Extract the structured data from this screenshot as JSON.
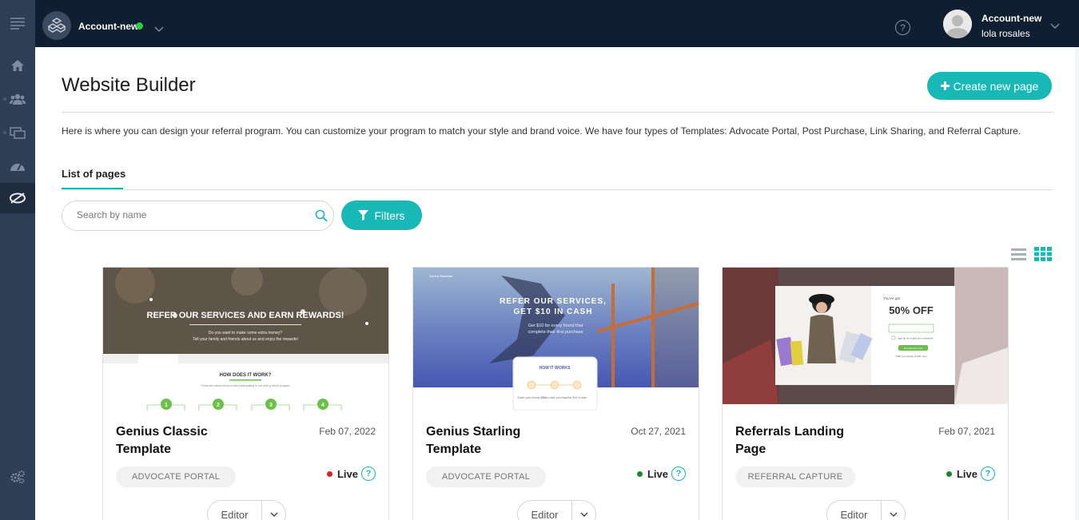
{
  "topbar": {
    "account_name": "Account-new",
    "user_account": "Account-new",
    "user_name": "lola rosales",
    "online_color": "#2ecc40"
  },
  "sidebar": {
    "items": [
      {
        "icon": "menu-icon"
      },
      {
        "icon": "home-icon"
      },
      {
        "icon": "users-icon"
      },
      {
        "icon": "screens-icon"
      },
      {
        "icon": "dashboard-icon"
      },
      {
        "icon": "website-builder-icon",
        "active": true
      },
      {
        "icon": "settings-icon"
      }
    ]
  },
  "main": {
    "title": "Website Builder",
    "create_button": "Create new page",
    "description": "Here is where you can design your referral program. You can customize your program to match your style and brand voice. We have four types of Templates: Advocate Portal, Post Purchase, Link Sharing, and Referral Capture.",
    "tab": "List of pages",
    "search_placeholder": "Search by name",
    "filters_button": "Filters",
    "accent": "#17b8b5"
  },
  "cards": [
    {
      "title": "Genius Classic Template",
      "date": "Feb 07, 2022",
      "badge": "ADVOCATE PORTAL",
      "status": "Live",
      "status_color": "#e02020",
      "editor": "Editor",
      "thumb": {
        "headline": "REFER OUR SERVICES AND EARN REWARDS!",
        "sub1": "Do you want to make some extra money?",
        "sub2": "Tell your family and friends about us and enjoy the rewards!",
        "steps_title": "HOW DOES IT WORK?",
        "steps_sub": "Follow the steps below to start participating in our refer a friend program",
        "steps": [
          "1",
          "2",
          "3",
          "4"
        ]
      }
    },
    {
      "title": "Genius Starling Template",
      "date": "Oct 27, 2021",
      "badge": "ADVOCATE PORTAL",
      "status": "Live",
      "status_color": "#1b8a2e",
      "editor": "Editor",
      "thumb": {
        "brand": "Genius Marketer",
        "headline1": "REFER OUR SERVICES,",
        "headline2": "GET $10 IN CASH",
        "sub1": "Get $10 for every friend that",
        "sub2": "complete their first purchase",
        "box_title": "HOW IT WORKS",
        "steps": [
          "Share your friends $10",
          "They make purchase",
          "Get $10 in cash"
        ]
      }
    },
    {
      "title": "Referrals Landing Page",
      "date": "Feb 07, 2021",
      "badge": "REFERRAL CAPTURE",
      "status": "Live",
      "status_color": "#1b8a2e",
      "editor": "Editor",
      "thumb": {
        "youve_got": "You've got",
        "offer": "50% OFF",
        "checkbox_text": "Sign up for emails and newsletter",
        "button": "Get discount now",
        "footnote": "*With a purchase of $40 more"
      }
    }
  ]
}
